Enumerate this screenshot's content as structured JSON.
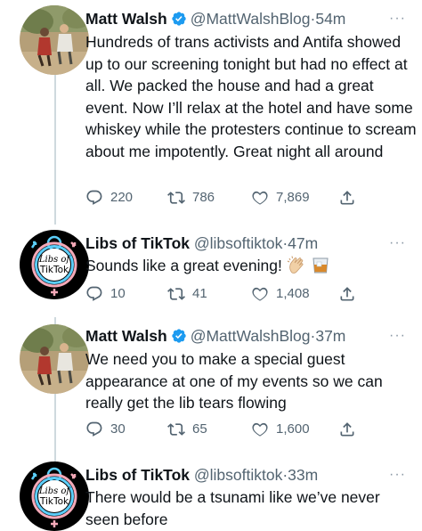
{
  "tweets": [
    {
      "author": "Matt Walsh",
      "verified": true,
      "handle": "@MattWalshBlog",
      "time": "54m",
      "avatar": "matt-walsh-avatar",
      "text": "Hundreds of trans activists and Antifa showed up to our screening tonight but had no effect at all. We packed the house and had a great event. Now I’ll relax at the hotel and have some whiskey while the protesters continue to scream about me impotently. Great night all around",
      "replies": "220",
      "retweets": "786",
      "likes": "7,869"
    },
    {
      "author": "Libs of TikTok",
      "verified": false,
      "handle": "@libsoftiktok",
      "time": "47m",
      "avatar": "libs-of-tiktok-avatar",
      "avatar_text_line1": "Libs of",
      "avatar_text_line2": "TikTok",
      "text": "Sounds like a great evening!",
      "emojis": [
        "clapping-hands-emoji",
        "whiskey-glass-emoji"
      ],
      "replies": "10",
      "retweets": "41",
      "likes": "1,408"
    },
    {
      "author": "Matt Walsh",
      "verified": true,
      "handle": "@MattWalshBlog",
      "time": "37m",
      "avatar": "matt-walsh-avatar",
      "text": "We need you to make a special guest appearance at one of my events so we can really get the lib tears flowing",
      "replies": "30",
      "retweets": "65",
      "likes": "1,600"
    },
    {
      "author": "Libs of TikTok",
      "verified": false,
      "handle": "@libsoftiktok",
      "time": "33m",
      "avatar": "libs-of-tiktok-avatar",
      "avatar_text_line1": "Libs of",
      "avatar_text_line2": "TikTok",
      "text": "There would be a tsunami like we’ve never seen before"
    }
  ],
  "separator": "·",
  "more_glyph": "···",
  "colors": {
    "verified_blue": "#1d9bf0",
    "muted_text": "#536471",
    "thread_line": "#cfd9de",
    "trans_blue": "#5bcefa",
    "trans_pink": "#f5a9b8"
  }
}
